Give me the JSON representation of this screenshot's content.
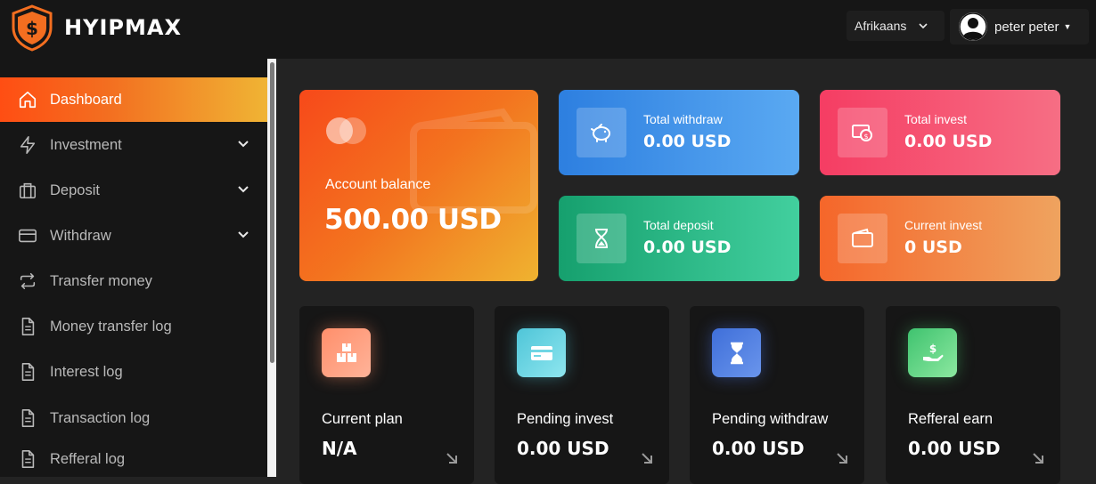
{
  "brand": {
    "name": "HYIPMAX"
  },
  "header": {
    "language": "Afrikaans",
    "user_name": "peter peter"
  },
  "sidebar": {
    "items": [
      {
        "label": "Dashboard",
        "icon": "home-icon",
        "active": true,
        "expandable": false
      },
      {
        "label": "Investment",
        "icon": "bolt-icon",
        "active": false,
        "expandable": true
      },
      {
        "label": "Deposit",
        "icon": "briefcase-icon",
        "active": false,
        "expandable": true
      },
      {
        "label": "Withdraw",
        "icon": "credit-card-icon",
        "active": false,
        "expandable": true
      },
      {
        "label": "Transfer money",
        "icon": "transfer-arrows-icon",
        "active": false,
        "expandable": false
      },
      {
        "label": "Money transfer log",
        "icon": "document-icon",
        "active": false,
        "expandable": false
      },
      {
        "label": "Interest log",
        "icon": "document-icon",
        "active": false,
        "expandable": false
      },
      {
        "label": "Transaction log",
        "icon": "document-icon",
        "active": false,
        "expandable": false
      },
      {
        "label": "Refferal log",
        "icon": "document-icon",
        "active": false,
        "expandable": false
      }
    ]
  },
  "balance": {
    "label": "Account balance",
    "value": "500.00 USD"
  },
  "stats": {
    "total_withdraw": {
      "label": "Total withdraw",
      "value": "0.00 USD",
      "icon": "piggy-bank-icon"
    },
    "total_invest": {
      "label": "Total invest",
      "value": "0.00 USD",
      "icon": "money-bill-icon"
    },
    "total_deposit": {
      "label": "Total deposit",
      "value": "0.00 USD",
      "icon": "hourglass-icon"
    },
    "current_invest": {
      "label": "Current invest",
      "value": "0 USD",
      "icon": "wallet-icon"
    }
  },
  "summary": [
    {
      "label": "Current plan",
      "value": "N/A",
      "icon": "boxes-icon"
    },
    {
      "label": "Pending invest",
      "value": "0.00 USD",
      "icon": "card-icon"
    },
    {
      "label": "Pending withdraw",
      "value": "0.00 USD",
      "icon": "hourglass-icon"
    },
    {
      "label": "Refferal earn",
      "value": "0.00 USD",
      "icon": "hand-dollar-icon"
    }
  ],
  "colors": {
    "accent_start": "#ff4e13",
    "accent_end": "#f0b434",
    "withdraw": "#2d7fe0",
    "invest": "#f53d63",
    "deposit": "#16a06e",
    "current": "#f5662a"
  }
}
